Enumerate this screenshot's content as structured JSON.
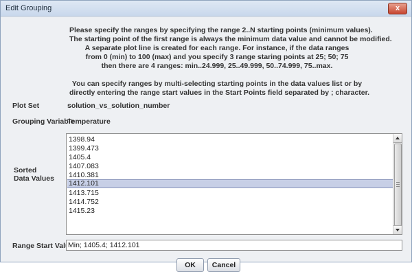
{
  "window": {
    "title": "Edit Grouping",
    "close_label": "x"
  },
  "instructions": {
    "lines": [
      "Please specify the ranges by specifying the range 2..N starting points (minimum values).",
      "The starting point of the first range is always the minimum data value and cannot be modified.",
      "A separate plot line is created for each range. For instance, if the data ranges",
      "from 0 (min) to 100 (max) and you specify 3 range staring points at 25; 50; 75",
      "then there are 4 ranges: min..24.999, 25..49.999, 50..74.999, 75..max.",
      "",
      "You can specify ranges by multi-selecting starting points in the data values list or by",
      "directly entering the range start values in the Start Points field separated by ; character."
    ]
  },
  "plot_set": {
    "label": "Plot Set",
    "value": "solution_vs_solution_number"
  },
  "grouping_variable": {
    "label": "Grouping Variable",
    "value": "Temperature"
  },
  "sorted_values": {
    "label_line1": "Sorted",
    "label_line2": "Data Values",
    "items": [
      "1398.94",
      "1399.473",
      "1405.4",
      "1407.083",
      "1410.381",
      "1412.101",
      "1413.715",
      "1414.752",
      "1415.23"
    ],
    "selected": "1412.101"
  },
  "range_start": {
    "label": "Range Start Values",
    "value": "Min;  1405.4;  1412.101"
  },
  "buttons": {
    "ok": "OK",
    "cancel": "Cancel"
  }
}
